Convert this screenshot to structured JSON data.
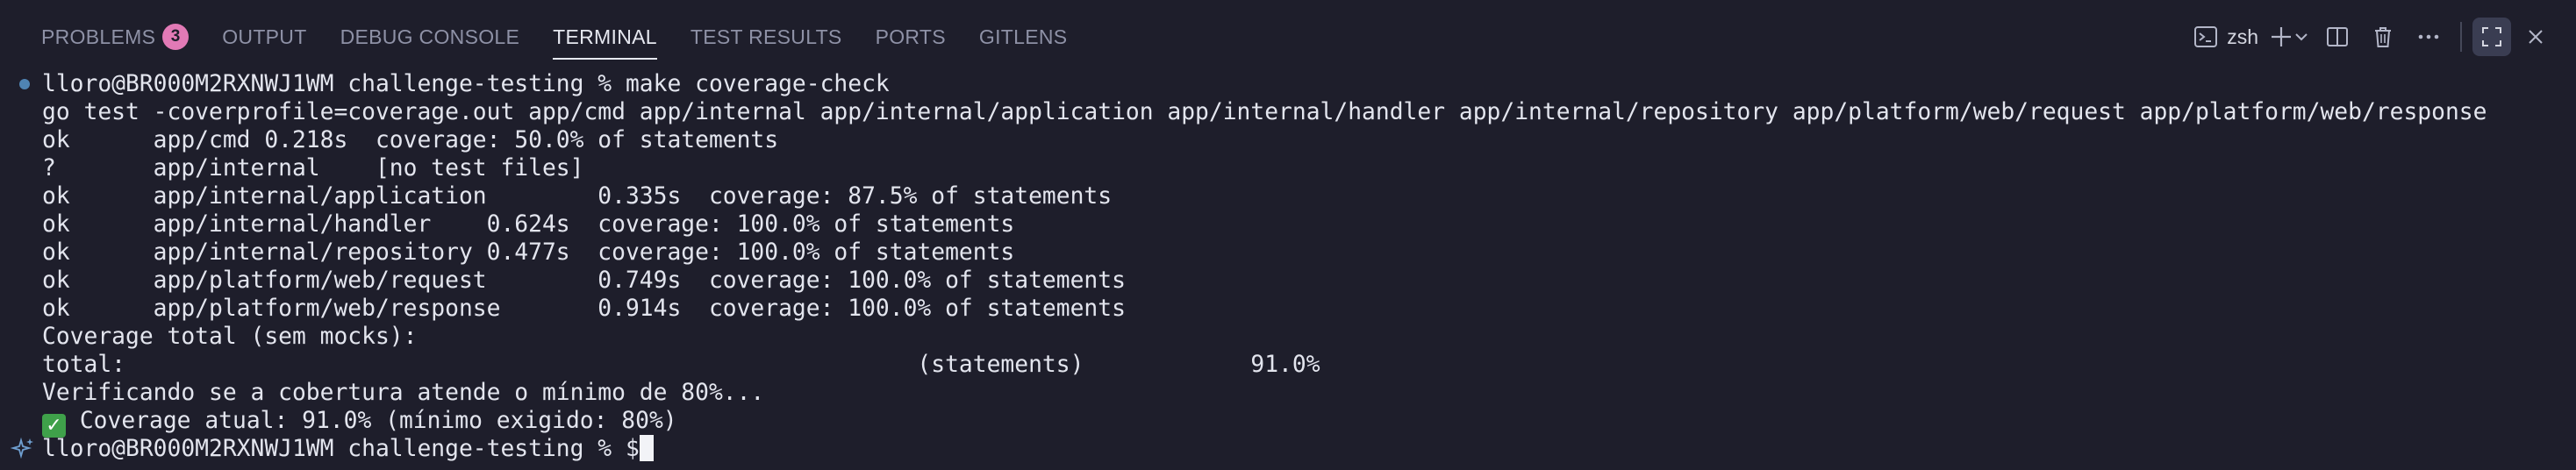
{
  "panel": {
    "tabs": [
      {
        "label": "PROBLEMS",
        "badge": "3",
        "active": false
      },
      {
        "label": "OUTPUT",
        "active": false
      },
      {
        "label": "DEBUG CONSOLE",
        "active": false
      },
      {
        "label": "TERMINAL",
        "active": true
      },
      {
        "label": "TEST RESULTS",
        "active": false
      },
      {
        "label": "PORTS",
        "active": false
      },
      {
        "label": "GITLENS",
        "active": false
      }
    ],
    "actions": {
      "shell_label": "zsh",
      "icons": [
        "terminal-icon",
        "plus-icon",
        "chevron-down-icon",
        "split-icon",
        "trash-icon",
        "ellipsis-icon",
        "maximize-icon",
        "close-icon"
      ]
    }
  },
  "terminal": {
    "lines": [
      "lloro@BR000M2RXNWJ1WM challenge-testing % make coverage-check",
      "go test -coverprofile=coverage.out app/cmd app/internal app/internal/application app/internal/handler app/internal/repository app/platform/web/request app/platform/web/response",
      "ok      app/cmd 0.218s  coverage: 50.0% of statements",
      "?       app/internal    [no test files]",
      "ok      app/internal/application        0.335s  coverage: 87.5% of statements",
      "ok      app/internal/handler    0.624s  coverage: 100.0% of statements",
      "ok      app/internal/repository 0.477s  coverage: 100.0% of statements",
      "ok      app/platform/web/request        0.749s  coverage: 100.0% of statements",
      "ok      app/platform/web/response       0.914s  coverage: 100.0% of statements",
      "Coverage total (sem mocks):",
      "total:                                                         (statements)            91.0%",
      "Verificando se a cobertura atende o mínimo de 80%...",
      " Coverage atual: 91.0% (mínimo exigido: 80%)",
      "lloro@BR000M2RXNWJ1WM challenge-testing % $"
    ],
    "check_glyph": "✓",
    "colors": {
      "background": "#1e1e2b",
      "text": "#e3e5ee",
      "prompt_dot": "#4f84b3",
      "check_bg": "#3fa14a",
      "badge": "#e27ab6"
    }
  }
}
